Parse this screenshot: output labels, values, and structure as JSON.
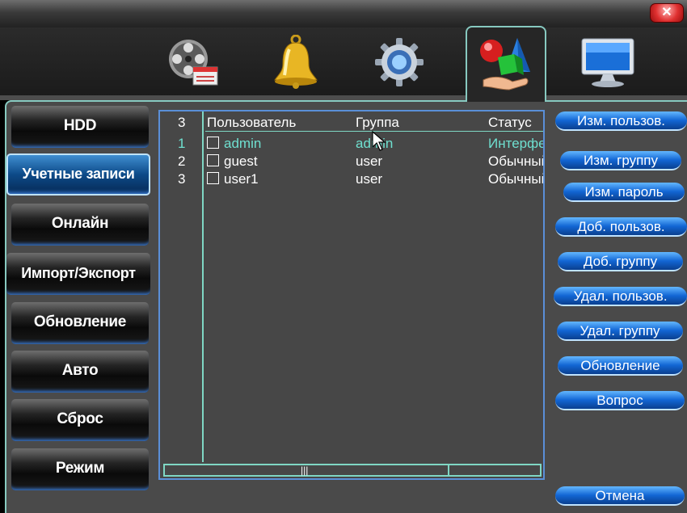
{
  "window": {
    "close_glyph": "✕"
  },
  "toolbar": {
    "tabs": [
      {
        "icon": "film-reel-icon"
      },
      {
        "icon": "bell-icon"
      },
      {
        "icon": "gear-icon"
      },
      {
        "icon": "system-shapes-icon",
        "active": true
      },
      {
        "icon": "monitor-icon"
      }
    ]
  },
  "sidebar": {
    "items": [
      {
        "label": "HDD"
      },
      {
        "label": "Учетные записи",
        "selected": true
      },
      {
        "label": "Онлайн"
      },
      {
        "label": "Импорт/Экспорт"
      },
      {
        "label": "Обновление"
      },
      {
        "label": "Авто"
      },
      {
        "label": "Сброс"
      },
      {
        "label": "Режим"
      }
    ]
  },
  "table": {
    "count": "3",
    "headers": {
      "user": "Пользователь",
      "group": "Группа",
      "status": "Статус"
    },
    "rows": [
      {
        "num": "1",
        "user": "admin",
        "group": "admin",
        "status": "Интерфейс",
        "highlight": true
      },
      {
        "num": "2",
        "user": "guest",
        "group": "user",
        "status": "Обычный"
      },
      {
        "num": "3",
        "user": "user1",
        "group": "user",
        "status": "Обычный"
      }
    ],
    "scroll_grip": "|||"
  },
  "actions": {
    "edit_user": "Изм. пользов.",
    "edit_group": "Изм. группу",
    "edit_password": "Изм. пароль",
    "add_user": "Доб. пользов.",
    "add_group": "Доб. группу",
    "delete_user": "Удал. пользов.",
    "delete_group": "Удал. группу",
    "update": "Обновление",
    "question": "Вопрос",
    "cancel": "Отмена"
  },
  "colors": {
    "accent": "#87c9c0",
    "highlight_text": "#6fe0d0",
    "button_blue": "#1266d4"
  }
}
